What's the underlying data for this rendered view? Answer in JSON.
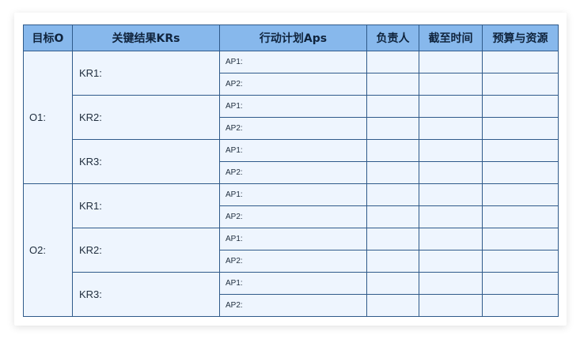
{
  "headers": {
    "objective": "目标O",
    "key_results": "关键结果KRs",
    "action_plans": "行动计划Aps",
    "owner": "负责人",
    "deadline": "截至时间",
    "budget": "预算与资源"
  },
  "objectives": [
    {
      "label": "O1:",
      "krs": [
        {
          "label": "KR1:",
          "aps": [
            "AP1:",
            "AP2:"
          ]
        },
        {
          "label": "KR2:",
          "aps": [
            "AP1:",
            "AP2:"
          ]
        },
        {
          "label": "KR3:",
          "aps": [
            "AP1:",
            "AP2:"
          ]
        }
      ]
    },
    {
      "label": "O2:",
      "krs": [
        {
          "label": "KR1:",
          "aps": [
            "AP1:",
            "AP2:"
          ]
        },
        {
          "label": "KR2:",
          "aps": [
            "AP1:",
            "AP2:"
          ]
        },
        {
          "label": "KR3:",
          "aps": [
            "AP1:",
            "AP2:"
          ]
        }
      ]
    }
  ],
  "colors": {
    "header_bg": "#87b8ec",
    "cell_bg": "#eef5fe",
    "border": "#2f5a8a"
  }
}
